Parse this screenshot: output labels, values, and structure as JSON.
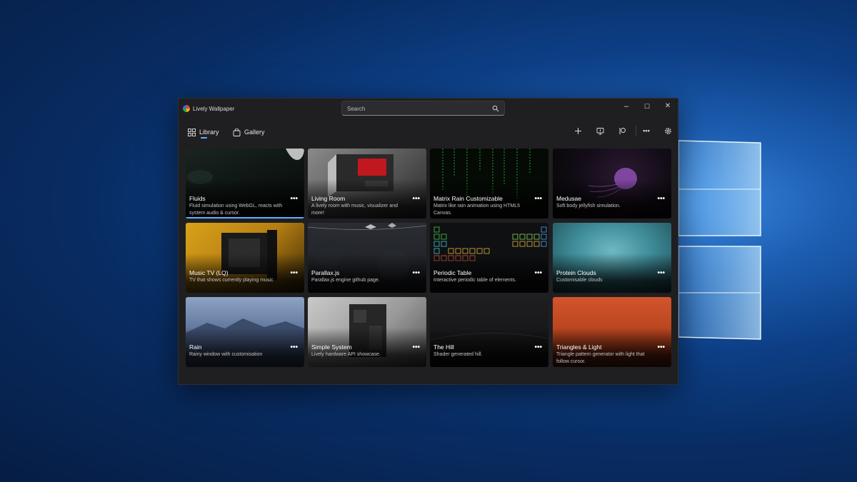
{
  "window": {
    "app_title": "Lively Wallpaper",
    "search_placeholder": "Search",
    "controls": {
      "minimize": "–",
      "maximize": "☐",
      "close": "✕"
    }
  },
  "nav": {
    "tabs": [
      {
        "label": "Library",
        "icon": "grid-icon",
        "active": true
      },
      {
        "label": "Gallery",
        "icon": "shopping-bag-icon",
        "active": false
      }
    ],
    "toolbar_icons": [
      "plus-icon",
      "monitor-icon",
      "customize-icon",
      "more-icon",
      "settings-icon"
    ],
    "accent": "#5eb0ff"
  },
  "wallpapers": [
    {
      "title": "Fluids",
      "description": "Fluid simulation using WebGL, reacts with system audio & cursor.",
      "selected": true
    },
    {
      "title": "Living Room",
      "description": "A lively room with music, visualizer and more!"
    },
    {
      "title": "Matrix Rain Customizable",
      "description": "Matrix like rain animation using HTML5 Canvas."
    },
    {
      "title": "Medusae",
      "description": "Soft body jellyfish simulation."
    },
    {
      "title": "Music TV (LQ)",
      "description": "TV that shows currently playing music"
    },
    {
      "title": "Parallax.js",
      "description": "Parallax.js engine github page."
    },
    {
      "title": "Periodic Table",
      "description": "Interactive periodic table of elements."
    },
    {
      "title": "Protein Clouds",
      "description": "Customisable clouds"
    },
    {
      "title": "Rain",
      "description": "Rainy window with customisation"
    },
    {
      "title": "Simple System",
      "description": "Lively hardware API showcase."
    },
    {
      "title": "The Hill",
      "description": "Shader generated hill."
    },
    {
      "title": "Triangles & Light",
      "description": "Triangle pattern generator with light that follow cursor."
    }
  ],
  "more_glyph": "•••"
}
